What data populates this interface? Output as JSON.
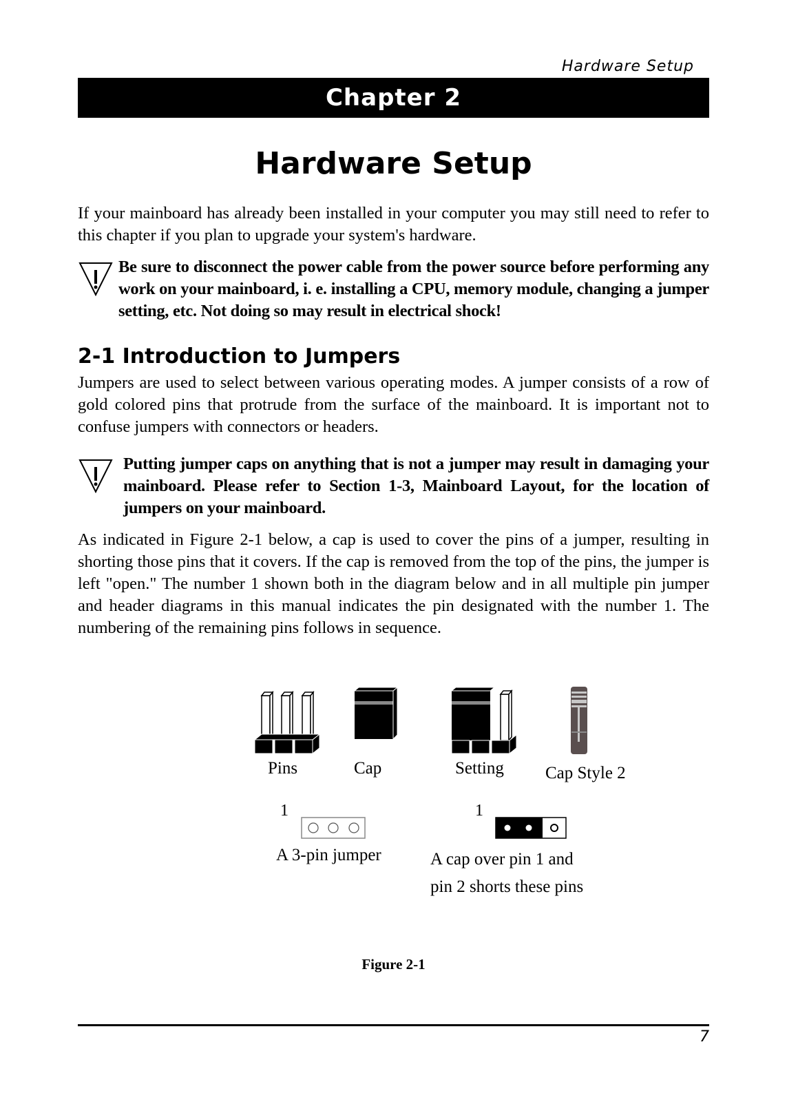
{
  "running_head": "Hardware Setup",
  "chapter_label": "Chapter 2",
  "page_title": "Hardware Setup",
  "intro_paragraph": "If your mainboard has already been installed in your computer you may still need to refer to this chapter if you plan to upgrade your system's hardware.",
  "warning_1": {
    "icon": "warning-triangle-icon",
    "text": "Be sure to disconnect the power cable from the power source before performing any work on your mainboard, i. e. installing a CPU, memory module, changing a jumper setting, etc.  Not doing so may result in electrical shock!"
  },
  "section": {
    "heading": "2-1 Introduction to Jumpers",
    "paragraph_1": "Jumpers are used to select between various operating modes.  A jumper consists of a row of gold colored pins that protrude from the surface of the mainboard.  It is important not to confuse jumpers with connectors or headers.",
    "warning_2": {
      "icon": "warning-triangle-icon",
      "text": "Putting jumper caps on anything that is not a jumper may result in damaging your mainboard.  Please refer to Section 1-3, Mainboard Layout, for the location of jumpers on your mainboard."
    },
    "paragraph_2": "As indicated in Figure 2-1 below, a cap is used to cover the pins of a jumper, resulting in shorting those pins that it covers.  If the cap is removed from the top of the pins, the jumper is left \"open.\"  The number 1 shown both in the diagram below and in all multiple pin jumper and header diagrams in this manual indicates the pin designated with the number 1.  The numbering of the remaining pins follows in sequence."
  },
  "figure": {
    "labels": [
      "Pins",
      "Cap",
      "Setting",
      "Cap Style 2"
    ],
    "pin_number": "1",
    "caption_left": "A  3-pin jumper",
    "caption_right_line1": "A  cap over pin 1 and",
    "caption_right_line2": "pin 2 shorts these pins",
    "title": "Figure  2-1",
    "colors": {
      "cap": "#000000",
      "cap_style_2": "#5a4f4f",
      "cap_band": "#c8c8c8"
    }
  },
  "page_number": "7"
}
